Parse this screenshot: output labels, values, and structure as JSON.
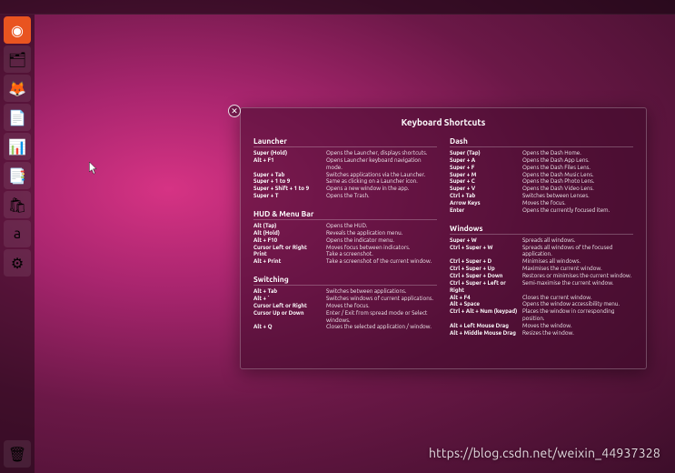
{
  "launcher_icons": [
    {
      "name": "ubuntu-icon",
      "glyph": "◉"
    },
    {
      "name": "files-icon",
      "glyph": "🗂"
    },
    {
      "name": "firefox-icon",
      "glyph": "🦊"
    },
    {
      "name": "document-icon",
      "glyph": "📄"
    },
    {
      "name": "calc-icon",
      "glyph": "📊"
    },
    {
      "name": "presentation-icon",
      "glyph": "📑"
    },
    {
      "name": "software-icon",
      "glyph": "🛍"
    },
    {
      "name": "amazon-icon",
      "glyph": "a"
    },
    {
      "name": "settings-icon",
      "glyph": "⚙"
    }
  ],
  "trash_icon": {
    "name": "trash-icon",
    "glyph": "🗑"
  },
  "overlay": {
    "title": "Keyboard Shortcuts",
    "close_glyph": "✕",
    "sections": {
      "launcher": {
        "title": "Launcher",
        "rows": [
          {
            "k": "Super (Hold)",
            "d": "Opens the Launcher, displays shortcuts."
          },
          {
            "k": "Alt + F1",
            "d": "Opens Launcher keyboard navigation mode."
          },
          {
            "k": "Super + Tab",
            "d": "Switches applications via the Launcher."
          },
          {
            "k": "Super + 1 to 9",
            "d": "Same as clicking on a Launcher icon."
          },
          {
            "k": "Super + Shift + 1 to 9",
            "d": "Opens a new window in the app."
          },
          {
            "k": "Super + T",
            "d": "Opens the Trash."
          }
        ]
      },
      "hud": {
        "title": "HUD & Menu Bar",
        "rows": [
          {
            "k": "Alt (Tap)",
            "d": "Opens the HUD."
          },
          {
            "k": "Alt (Hold)",
            "d": "Reveals the application menu."
          },
          {
            "k": "Alt + F10",
            "d": "Opens the indicator menu."
          },
          {
            "k": "Cursor Left or Right",
            "d": "Moves focus between indicators."
          },
          {
            "k": "Print",
            "d": "Take a screenshot."
          },
          {
            "k": "Alt + Print",
            "d": "Take a screenshot of the current window."
          }
        ]
      },
      "switching": {
        "title": "Switching",
        "rows": [
          {
            "k": "Alt + Tab",
            "d": "Switches between applications."
          },
          {
            "k": "Alt + `",
            "d": "Switches windows of current applications."
          },
          {
            "k": "Cursor Left or Right",
            "d": "Moves the focus."
          },
          {
            "k": "Cursor Up or Down",
            "d": "Enter / Exit from spread mode or Select windows."
          },
          {
            "k": "Alt + Q",
            "d": "Closes the selected application / window."
          }
        ]
      },
      "dash": {
        "title": "Dash",
        "rows": [
          {
            "k": "Super (Tap)",
            "d": "Opens the Dash Home."
          },
          {
            "k": "Super + A",
            "d": "Opens the Dash App Lens."
          },
          {
            "k": "Super + F",
            "d": "Opens the Dash Files Lens."
          },
          {
            "k": "Super + M",
            "d": "Opens the Dash Music Lens."
          },
          {
            "k": "Super + C",
            "d": "Opens the Dash Photo Lens."
          },
          {
            "k": "Super + V",
            "d": "Opens the Dash Video Lens."
          },
          {
            "k": "Ctrl + Tab",
            "d": "Switches between Lenses."
          },
          {
            "k": "Arrow Keys",
            "d": "Moves the focus."
          },
          {
            "k": "Enter",
            "d": "Opens the currently focused item."
          }
        ]
      },
      "windows": {
        "title": "Windows",
        "rows": [
          {
            "k": "Super + W",
            "d": "Spreads all windows."
          },
          {
            "k": "Ctrl + Super + W",
            "d": "Spreads all windows of the focused application."
          },
          {
            "k": "Ctrl + Super + D",
            "d": "Minimises all windows."
          },
          {
            "k": "Ctrl + Super + Up",
            "d": "Maximises the current window."
          },
          {
            "k": "Ctrl + Super + Down",
            "d": "Restores or minimises the current window."
          },
          {
            "k": "Ctrl + Super + Left or Right",
            "d": "Semi-maximise the current window."
          },
          {
            "k": "Alt + F4",
            "d": "Closes the current window."
          },
          {
            "k": "Alt + Space",
            "d": "Opens the window accessibility menu."
          },
          {
            "k": "Ctrl + Alt + Num (keypad)",
            "d": "Places the window in corresponding position."
          },
          {
            "k": "Alt + Left Mouse Drag",
            "d": "Moves the window."
          },
          {
            "k": "Alt + Middle Mouse Drag",
            "d": "Resizes the window."
          }
        ]
      }
    }
  },
  "watermark": "https://blog.csdn.net/weixin_44937328"
}
